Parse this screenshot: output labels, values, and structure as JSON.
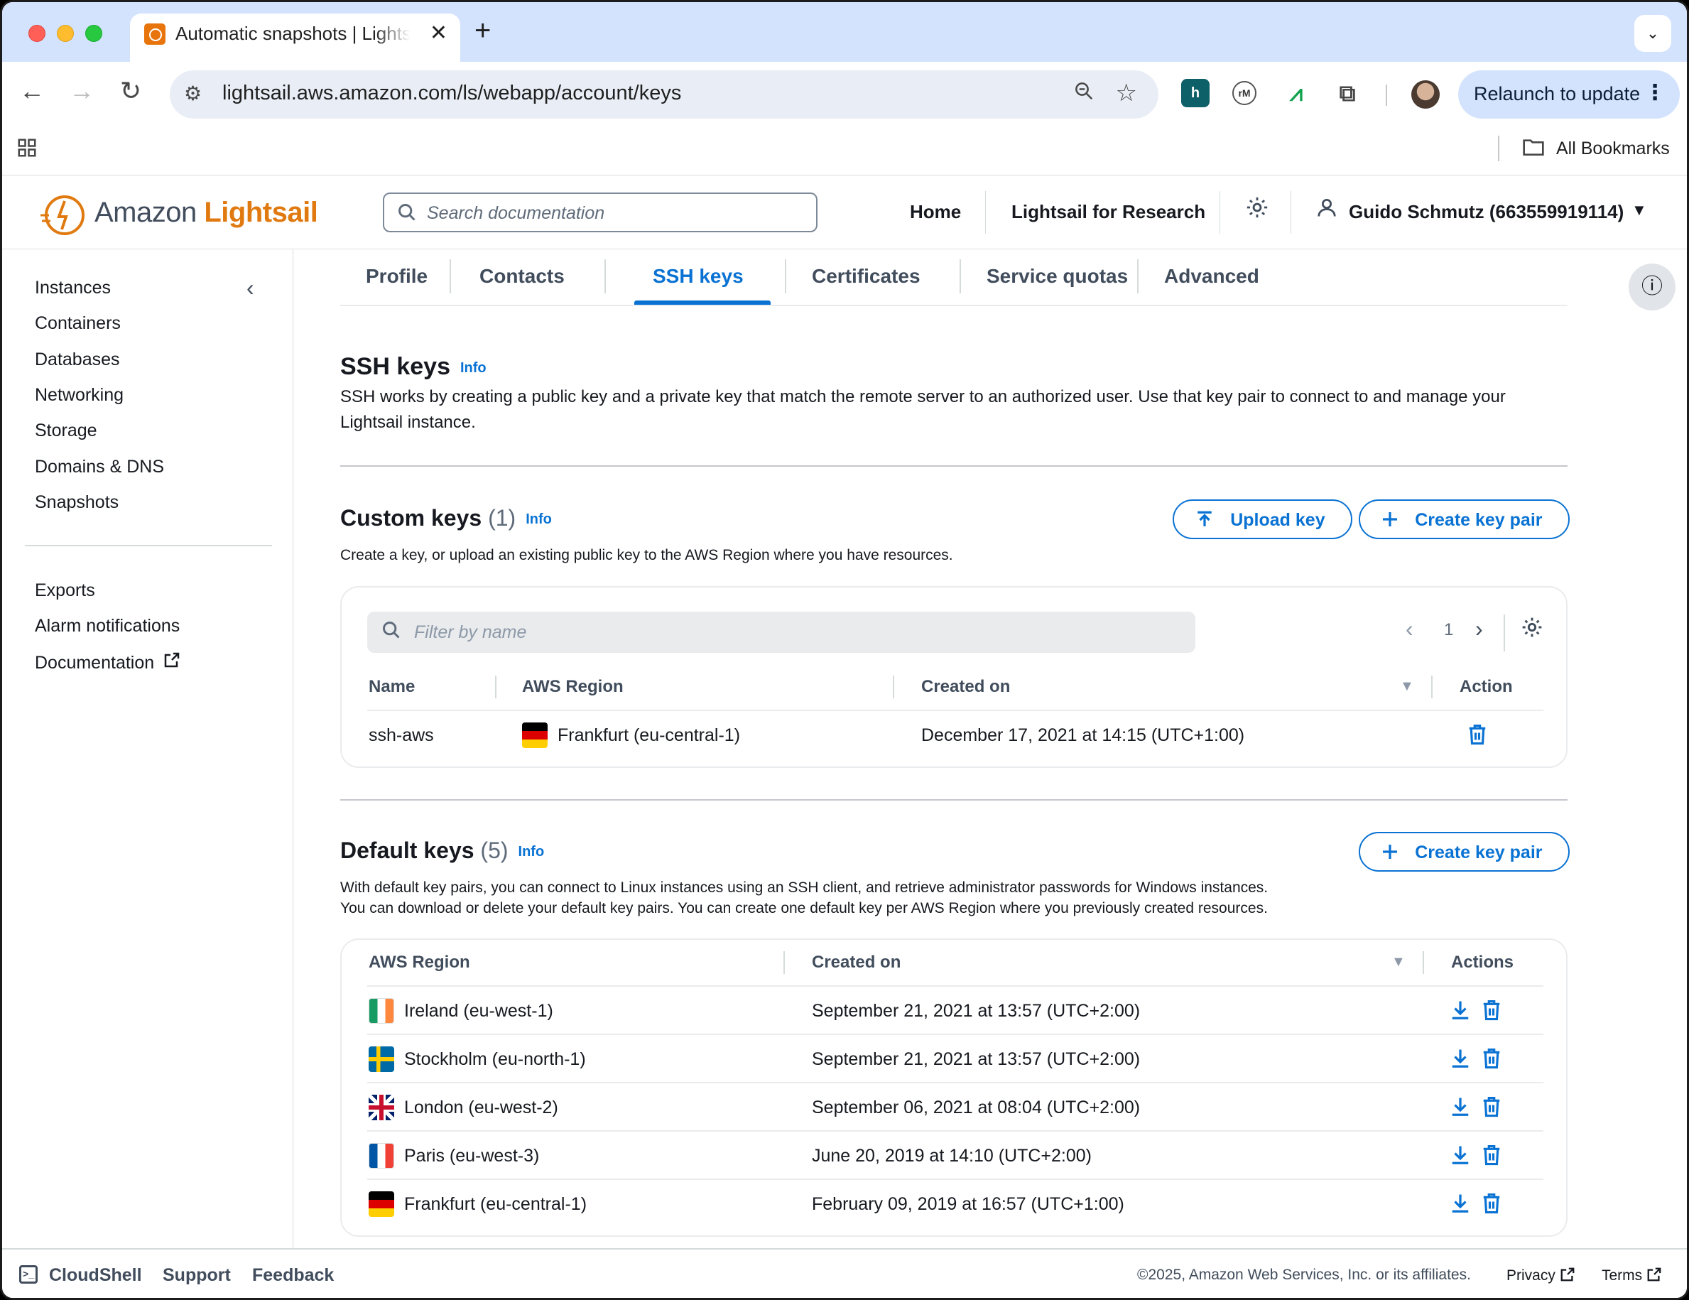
{
  "browser": {
    "tab_title": "Automatic snapshots | Lightsail",
    "url": "lightsail.aws.amazon.com/ls/webapp/account/keys",
    "relaunch_label": "Relaunch to update",
    "all_bookmarks": "All Bookmarks"
  },
  "header": {
    "logo_amazon": "Amazon",
    "logo_lightsail": "Lightsail",
    "search_placeholder": "Search documentation",
    "nav": {
      "home": "Home",
      "research": "Lightsail for Research"
    },
    "user": "Guido Schmutz (663559919114)"
  },
  "sidebar": {
    "items": [
      "Instances",
      "Containers",
      "Databases",
      "Networking",
      "Storage",
      "Domains & DNS",
      "Snapshots"
    ],
    "secondary": [
      "Exports",
      "Alarm notifications",
      "Documentation"
    ]
  },
  "tabs": [
    "Profile",
    "Contacts",
    "SSH keys",
    "Certificates",
    "Service quotas",
    "Advanced"
  ],
  "active_tab": "SSH keys",
  "ssh": {
    "title": "SSH keys",
    "info": "Info",
    "description": "SSH works by creating a public key and a private key that match the remote server to an authorized user. Use that key pair to connect to and manage your Lightsail instance."
  },
  "custom_keys": {
    "title": "Custom keys",
    "count": "(1)",
    "info": "Info",
    "description": "Create a key, or upload an existing public key to the AWS Region where you have resources.",
    "upload_button": "Upload key",
    "create_button": "Create key pair",
    "filter_placeholder": "Filter by name",
    "page": "1",
    "columns": {
      "name": "Name",
      "region": "AWS Region",
      "created": "Created on",
      "action": "Action"
    },
    "rows": [
      {
        "name": "ssh-aws",
        "flag": "de",
        "region": "Frankfurt (eu-central-1)",
        "created": "December 17, 2021 at 14:15 (UTC+1:00)"
      }
    ]
  },
  "default_keys": {
    "title": "Default keys",
    "count": "(5)",
    "info": "Info",
    "description_1": "With default key pairs, you can connect to Linux instances using an SSH client, and retrieve administrator passwords for Windows instances.",
    "description_2": "You can download or delete your default key pairs. You can create one default key per AWS Region where you previously created resources.",
    "create_button": "Create key pair",
    "columns": {
      "region": "AWS Region",
      "created": "Created on",
      "actions": "Actions"
    },
    "rows": [
      {
        "flag": "ie",
        "region": "Ireland (eu-west-1)",
        "created": "September 21, 2021 at 13:57 (UTC+2:00)"
      },
      {
        "flag": "se",
        "region": "Stockholm (eu-north-1)",
        "created": "September 21, 2021 at 13:57 (UTC+2:00)"
      },
      {
        "flag": "gb",
        "region": "London (eu-west-2)",
        "created": "September 06, 2021 at 08:04 (UTC+2:00)"
      },
      {
        "flag": "fr",
        "region": "Paris (eu-west-3)",
        "created": "June 20, 2019 at 14:10 (UTC+2:00)"
      },
      {
        "flag": "de",
        "region": "Frankfurt (eu-central-1)",
        "created": "February 09, 2019 at 16:57 (UTC+1:00)"
      }
    ]
  },
  "footer": {
    "cloudshell": "CloudShell",
    "support": "Support",
    "feedback": "Feedback",
    "copyright": "©2025, Amazon Web Services, Inc. or its affiliates.",
    "privacy": "Privacy",
    "terms": "Terms"
  },
  "colors": {
    "accent": "#0972d3",
    "brand": "#e07a10",
    "chrome": "#d3e3fd"
  }
}
